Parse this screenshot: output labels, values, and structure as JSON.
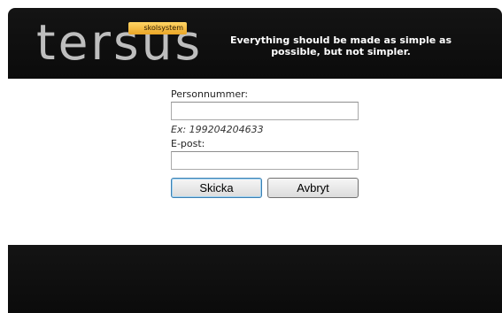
{
  "header": {
    "logo_text": "tersus",
    "logo_tag": "skolsystem",
    "motto": "Everything should be made as simple as possible, but not simpler."
  },
  "form": {
    "personnummer_label": "Personnummer:",
    "personnummer_value": "",
    "personnummer_hint": "Ex: 199204204633",
    "email_label": "E-post:",
    "email_value": "",
    "submit_label": "Skicka",
    "cancel_label": "Avbryt"
  },
  "colors": {
    "header_bg": "#111111",
    "logo_text": "#bebebe",
    "logo_tag": "#f0b43a",
    "page_bg": "#ffffff"
  }
}
